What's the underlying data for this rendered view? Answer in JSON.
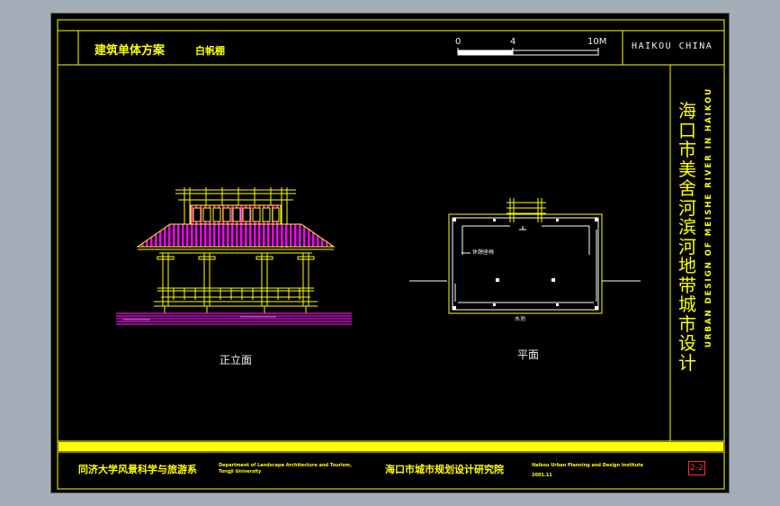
{
  "header": {
    "title": "建筑单体方案",
    "subtitle": "白帆棚",
    "scale_labels": [
      "0",
      "4",
      "10M"
    ],
    "location": "HAIKOU CHINA"
  },
  "side": {
    "title_cn": "海口市美舍河滨河地带城市设计",
    "title_en": "URBAN DESIGN OF MEISHE RIVER IN HAIKOU"
  },
  "views": {
    "elevation_label": "正立面",
    "plan_label": "平面",
    "plan_note_1": "休憩座椅",
    "plan_note_2": "水池"
  },
  "footer": {
    "school": "同济大学风景科学与旅游系",
    "school_en_1": "Department of Landscape Architecture and Tourism,",
    "school_en_2": "Tongji University",
    "institute": "海口市城市规划设计研究院",
    "institute_en": "Haikou Urban Planning and Design Institute",
    "date": "2001.11",
    "sheet_no": "2-2"
  },
  "colors": {
    "frame": "#ffff00",
    "roof": "#ff00ff",
    "text": "#ffffff",
    "sheet_no": "#ff3030"
  }
}
